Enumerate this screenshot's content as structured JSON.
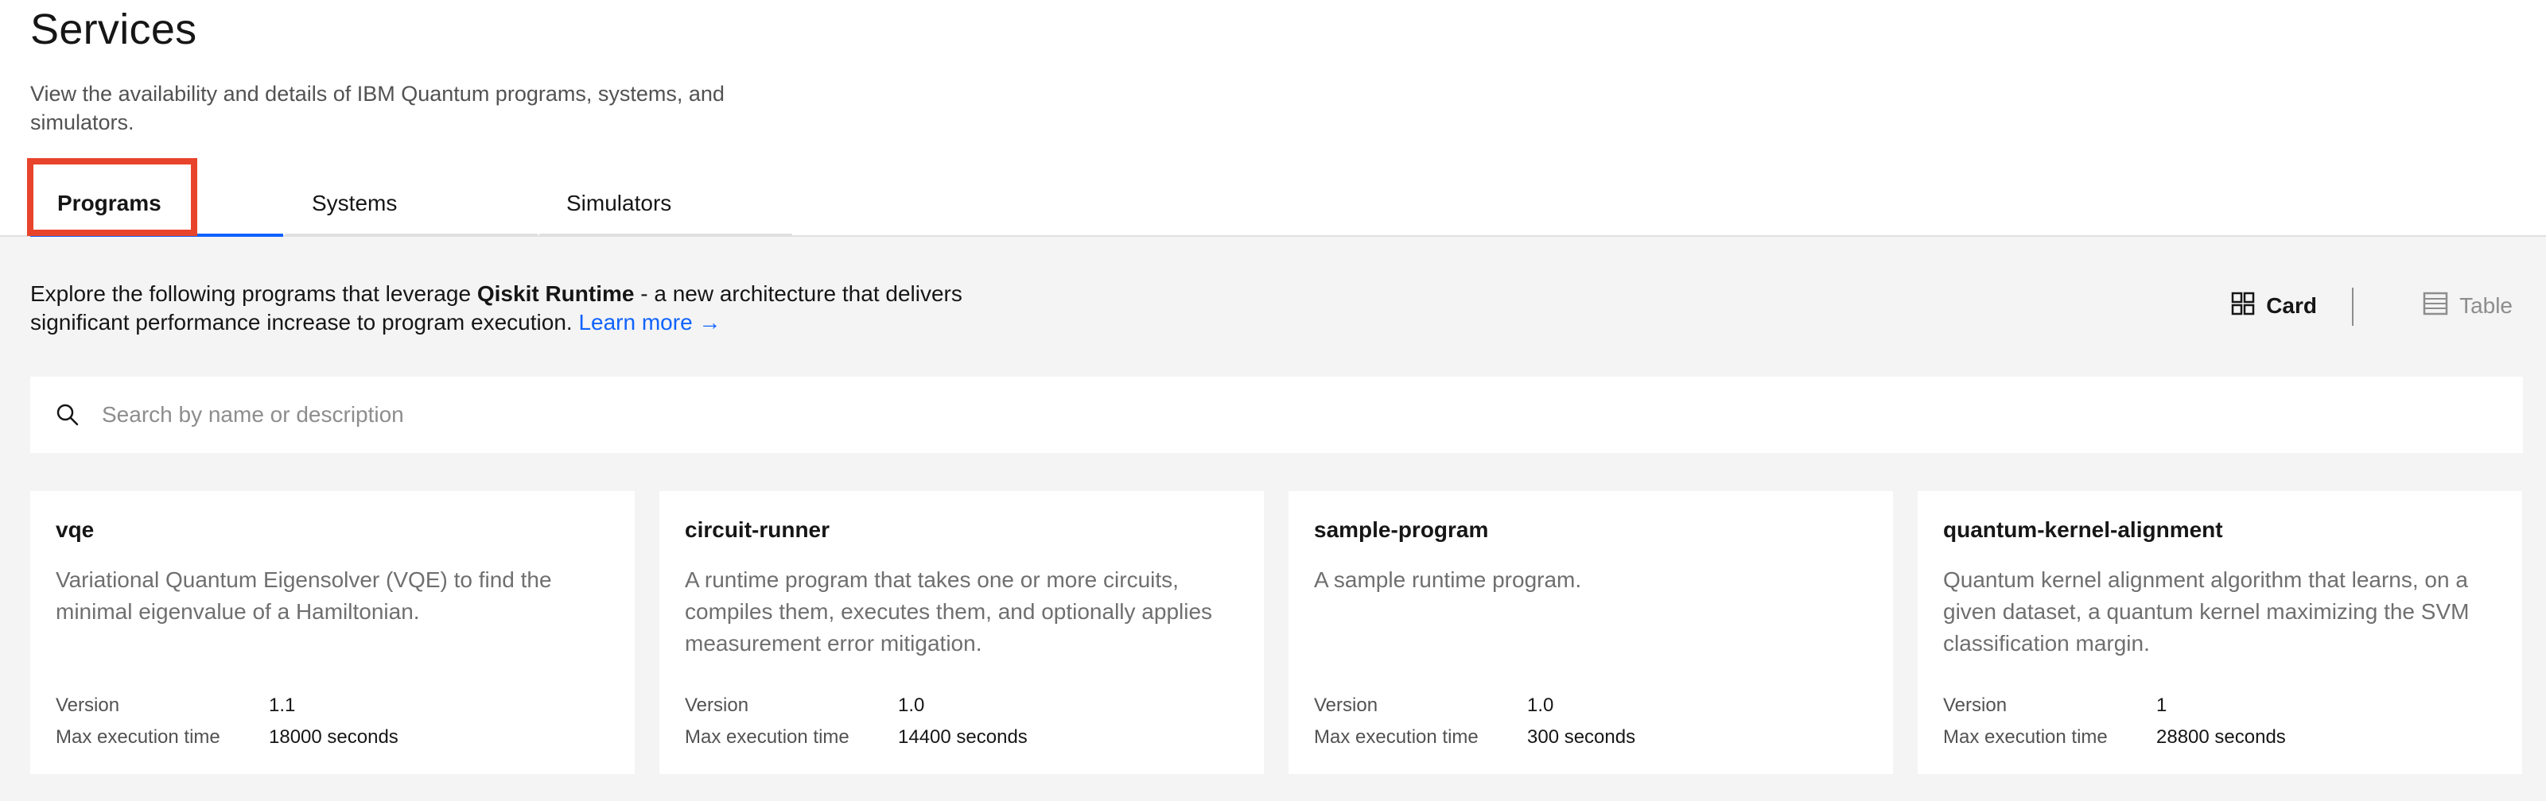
{
  "page": {
    "title": "Services",
    "description": "View the availability and details of IBM Quantum programs, systems, and simulators."
  },
  "tabs": [
    {
      "label": "Programs",
      "selected": true
    },
    {
      "label": "Systems",
      "selected": false
    },
    {
      "label": "Simulators",
      "selected": false
    }
  ],
  "intro": {
    "text_before": "Explore the following programs that leverage ",
    "bold": "Qiskit Runtime",
    "text_after": " - a new architecture that delivers significant performance increase to program execution. ",
    "link": "Learn more →"
  },
  "view_toggle": {
    "card_label": "Card",
    "table_label": "Table",
    "active": "card"
  },
  "search": {
    "placeholder": "Search by name or description",
    "value": ""
  },
  "cards": [
    {
      "name": "vqe",
      "description": "Variational Quantum Eigensolver (VQE) to find the minimal eigenvalue of a Hamiltonian.",
      "version_label": "Version",
      "version": "1.1",
      "max_time_label": "Max execution time",
      "max_time": "18000 seconds"
    },
    {
      "name": "circuit-runner",
      "description": "A runtime program that takes one or more circuits, compiles them, executes them, and optionally applies measurement error mitigation.",
      "version_label": "Version",
      "version": "1.0",
      "max_time_label": "Max execution time",
      "max_time": "14400 seconds"
    },
    {
      "name": "sample-program",
      "description": "A sample runtime program.",
      "version_label": "Version",
      "version": "1.0",
      "max_time_label": "Max execution time",
      "max_time": "300 seconds"
    },
    {
      "name": "quantum-kernel-alignment",
      "description": "Quantum kernel alignment algorithm that learns, on a given dataset, a quantum kernel maximizing the SVM classification margin.",
      "version_label": "Version",
      "version": "1",
      "max_time_label": "Max execution time",
      "max_time": "28800 seconds"
    }
  ],
  "colors": {
    "accent": "#0f62fe",
    "highlight": "#e8432b",
    "background": "#f4f4f4"
  }
}
